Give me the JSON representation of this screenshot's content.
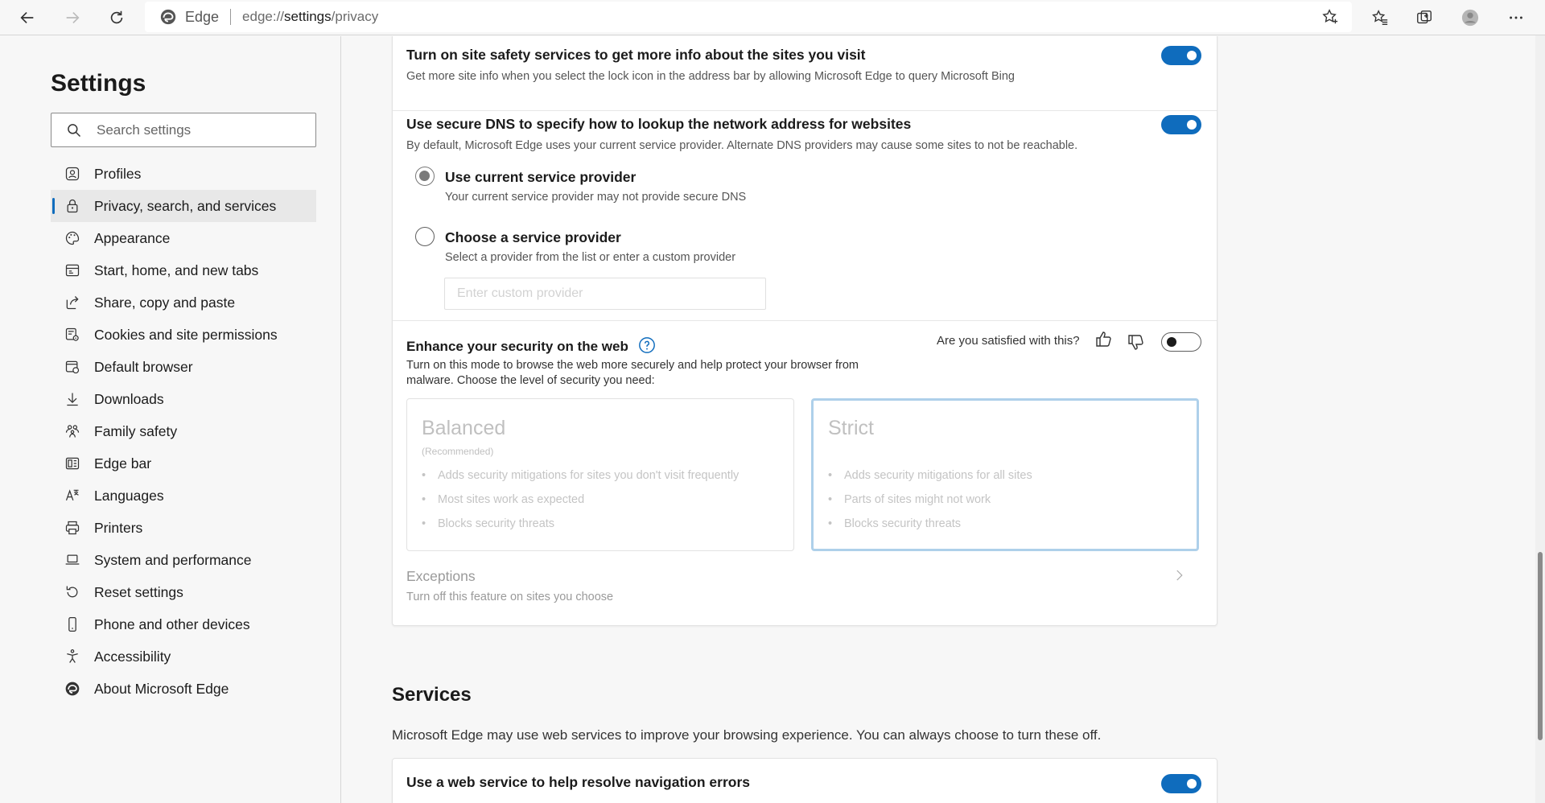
{
  "toolbar": {
    "site_name": "Edge",
    "url_scheme": "edge://",
    "url_path": "settings",
    "url_rest": "/privacy"
  },
  "sidebar": {
    "title": "Settings",
    "search_placeholder": "Search settings",
    "items": [
      {
        "label": "Profiles",
        "icon": "profile-icon"
      },
      {
        "label": "Privacy, search, and services",
        "icon": "lock-icon",
        "active": true
      },
      {
        "label": "Appearance",
        "icon": "palette-icon"
      },
      {
        "label": "Start, home, and new tabs",
        "icon": "window-icon"
      },
      {
        "label": "Share, copy and paste",
        "icon": "share-icon"
      },
      {
        "label": "Cookies and site permissions",
        "icon": "cookie-settings-icon"
      },
      {
        "label": "Default browser",
        "icon": "browser-icon"
      },
      {
        "label": "Downloads",
        "icon": "download-icon"
      },
      {
        "label": "Family safety",
        "icon": "family-icon"
      },
      {
        "label": "Edge bar",
        "icon": "edge-bar-icon"
      },
      {
        "label": "Languages",
        "icon": "languages-icon"
      },
      {
        "label": "Printers",
        "icon": "printer-icon"
      },
      {
        "label": "System and performance",
        "icon": "laptop-icon"
      },
      {
        "label": "Reset settings",
        "icon": "reset-icon"
      },
      {
        "label": "Phone and other devices",
        "icon": "phone-icon"
      },
      {
        "label": "Accessibility",
        "icon": "accessibility-icon"
      },
      {
        "label": "About Microsoft Edge",
        "icon": "edge-logo-icon"
      }
    ]
  },
  "site_safety": {
    "title": "Turn on site safety services to get more info about the sites you visit",
    "desc": "Get more site info when you select the lock icon in the address bar by allowing Microsoft Edge to query Microsoft Bing",
    "enabled": true
  },
  "secure_dns": {
    "title": "Use secure DNS to specify how to lookup the network address for websites",
    "desc": "By default, Microsoft Edge uses your current service provider. Alternate DNS providers may cause some sites to not be reachable.",
    "enabled": true,
    "option_current_title": "Use current service provider",
    "option_current_desc": "Your current service provider may not provide secure DNS",
    "option_choose_title": "Choose a service provider",
    "option_choose_desc": "Select a provider from the list or enter a custom provider",
    "custom_placeholder": "Enter custom provider"
  },
  "enhance": {
    "title": "Enhance your security on the web",
    "feedback_question": "Are you satisfied with this?",
    "enabled": false,
    "desc_line1": "Turn on this mode to browse the web more securely and help protect your browser from",
    "desc_line2": "malware. Choose the level of security you need:",
    "balanced": {
      "title": "Balanced",
      "recommended": "(Recommended)",
      "bullets": [
        "Adds security mitigations for sites you don't visit frequently",
        "Most sites work as expected",
        "Blocks security threats"
      ]
    },
    "strict": {
      "title": "Strict",
      "bullets": [
        "Adds security mitigations for all sites",
        "Parts of sites might not work",
        "Blocks security threats"
      ]
    },
    "exceptions_title": "Exceptions",
    "exceptions_desc": "Turn off this feature on sites you choose"
  },
  "services": {
    "heading": "Services",
    "desc": "Microsoft Edge may use web services to improve your browsing experience. You can always choose to turn these off.",
    "nav_errors_title": "Use a web service to help resolve navigation errors",
    "nav_errors_enabled": true
  },
  "colors": {
    "accent": "#0f6cbd",
    "annotation_arrow": "#ff0000"
  }
}
